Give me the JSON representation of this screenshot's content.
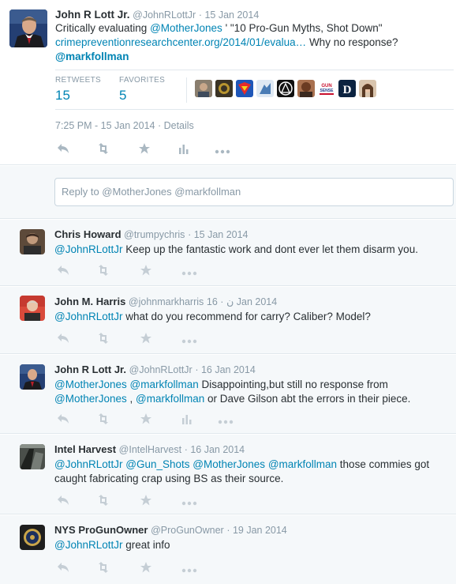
{
  "main_tweet": {
    "name": "John R Lott Jr.",
    "handle": "@JohnRLottJr",
    "date": "· 15 Jan 2014",
    "text_1a": "Critically evaluating ",
    "mention_1": "@MotherJones",
    "text_1b": " '   \"10 Pro-Gun Myths, Shot Down\"",
    "link": "crimepreventionresearchcenter.org/2014/01/evalua…",
    "text_2b": " Why no response?",
    "mention_2": "@markfollman",
    "retweets_label": "RETWEETS",
    "retweets": "15",
    "favorites_label": "FAVORITES",
    "favorites": "5",
    "timestamp": "7:25 PM - 15 Jan 2014",
    "details": " · Details",
    "colors": {
      "accent": "#0084b4",
      "text": "#292f33",
      "muted": "#8899a6",
      "icon": "#aab8c2"
    }
  },
  "reply_box": {
    "placeholder": "Reply to @MotherJones @markfollman"
  },
  "replies": [
    {
      "name": "Chris Howard",
      "handle": "@trumpychris",
      "date": "· 15 Jan 2014",
      "mention": "@JohnRLottJr",
      "text": "  Keep up the fantastic work and dont ever let them disarm you."
    },
    {
      "name": "John M. Harris",
      "handle": "@johnmarkharris",
      "glyph": "ن",
      "date": "· 16 Jan 2014",
      "mention": "@JohnRLottJr",
      "text": " what do you recommend for carry? Caliber? Model?"
    },
    {
      "name": "John R Lott Jr.",
      "handle": "@JohnRLottJr",
      "date": "· 16 Jan 2014",
      "line1_m1": "@MotherJones",
      "line1_m2": "@markfollman",
      "line1_t": " Disappointing,but still no response from",
      "line2_m1": "@MotherJones",
      "line2_sep": " , ",
      "line2_m2": "@markfollman",
      "line2_t": " or Dave Gilson abt the errors in their piece."
    },
    {
      "name": "Intel Harvest",
      "handle": "@IntelHarvest",
      "date": "· 16 Jan 2014",
      "m1": "@JohnRLottJr",
      "m2": "@Gun_Shots",
      "m3": "@MotherJones",
      "m4": "@markfollman",
      "t1": " those commies got",
      "t2": "caught fabricating crap using BS as their source."
    },
    {
      "name": "NYS ProGunOwner",
      "handle": "@ProGunOwner",
      "date": "· 19 Jan 2014",
      "mention": "@JohnRLottJr",
      "text": " great info"
    }
  ],
  "icons": [
    "reply-icon",
    "retweet-icon",
    "favorite-icon",
    "stats-icon",
    "more-icon"
  ]
}
